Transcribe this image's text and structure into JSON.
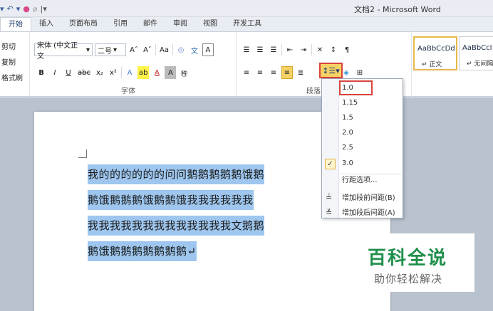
{
  "window": {
    "title": "文档2 - Microsoft Word"
  },
  "tabs": [
    "开始",
    "插入",
    "页面布局",
    "引用",
    "邮件",
    "审阅",
    "视图",
    "开发工具"
  ],
  "clipboard": {
    "cut": "剪切",
    "copy": "复制",
    "format_painter": "格式刷"
  },
  "font_group": {
    "label": "字体",
    "font_name": "宋体 (中文正文",
    "font_size": "二号",
    "grow": "Aˆ",
    "shrink": "Aˇ",
    "case": "Aa",
    "bold": "B",
    "italic": "I",
    "underline": "U",
    "strike": "abc",
    "subscript": "x₂",
    "superscript": "x²",
    "font_color": "A",
    "char_shading": "A"
  },
  "paragraph_group": {
    "label": "段落"
  },
  "styles": [
    {
      "preview": "AaBbCcDd",
      "name": "↵ 正文"
    },
    {
      "preview": "AaBbCcI",
      "name": "↵ 无间隔"
    }
  ],
  "document_lines": [
    "我的的的的的的问问鹅鹅鹅鹅鹅饿鹅",
    "鹅饿鹅鹅鹅饿鹅鹅饿我我我我我我",
    "我我我我我我我我我我我我我文鹅鹅",
    "鹅饿鹅鹅鹅鹅鹅鹅鹅↵"
  ],
  "line_spacing_menu": {
    "items": [
      "1.0",
      "1.15",
      "1.5",
      "2.0",
      "2.5",
      "3.0"
    ],
    "selected": "1.0",
    "checked": "3.0",
    "options": "行距选项...",
    "add_before": "增加段前间距(B)",
    "add_after": "增加段后间距(A)"
  },
  "watermark": {
    "title": "百科全说",
    "subtitle": "助你轻松解决"
  }
}
